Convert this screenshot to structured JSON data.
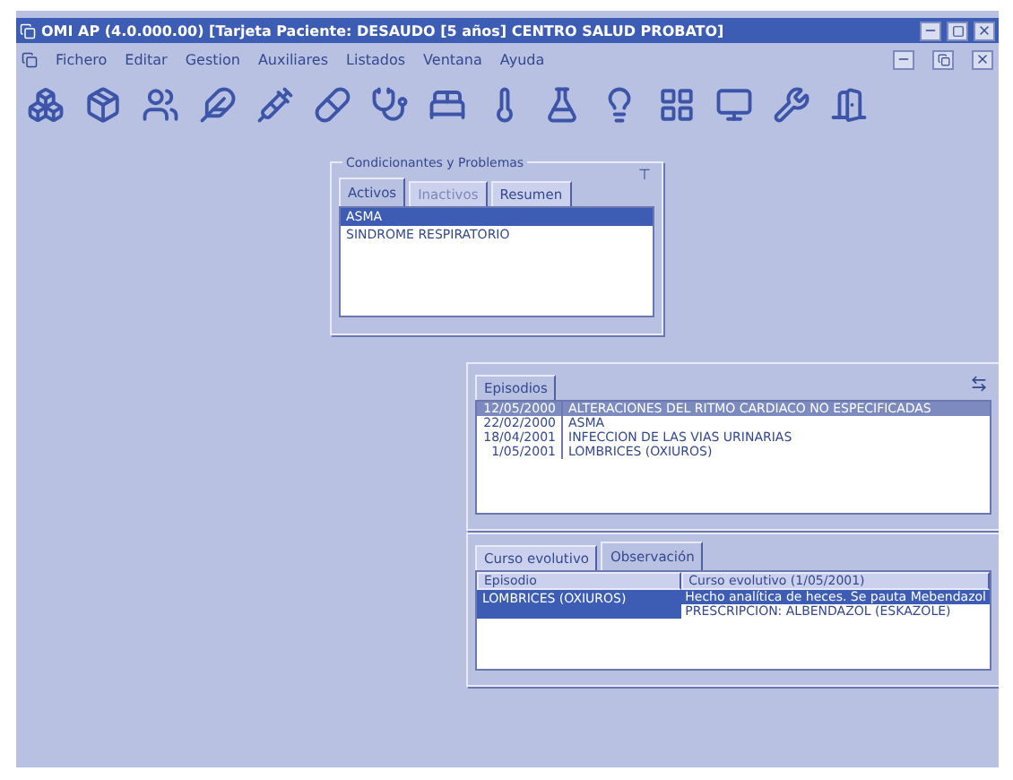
{
  "window": {
    "title": "OMI AP (4.0.000.00)   [Tarjeta Paciente: DESAUDO [5 años] CENTRO SALUD PROBATO]"
  },
  "menu": [
    "Fichero",
    "Editar",
    "Gestion",
    "Auxiliares",
    "Listados",
    "Ventana",
    "Ayuda"
  ],
  "problems_panel": {
    "title": "Condicionantes y Problemas",
    "pin": "⊤",
    "tabs": [
      {
        "label": "Activos",
        "selected": true,
        "disabled": false
      },
      {
        "label": "Inactivos",
        "selected": false,
        "disabled": true
      },
      {
        "label": "Resumen",
        "selected": false,
        "disabled": false
      }
    ],
    "items": [
      {
        "label": "ASMA",
        "selected": true
      },
      {
        "label": "SINDROME RESPIRATORIO",
        "selected": false
      }
    ]
  },
  "episodes_panel": {
    "tabs": [
      {
        "label": "Episodios",
        "selected": true
      }
    ],
    "rows": [
      {
        "date": "12/05/2000",
        "name": "ALTERACIONES DEL RITMO CARDIACO NO ESPECIFICADAS",
        "selected": true
      },
      {
        "date": "22/02/2000",
        "name": "ASMA",
        "selected": false
      },
      {
        "date": "18/04/2001",
        "name": "INFECCION DE LAS VIAS URINARIAS",
        "selected": false
      },
      {
        "date": "1/05/2001",
        "name": "LOMBRICES (OXIUROS)",
        "selected": false
      }
    ]
  },
  "course_panel": {
    "tabs": [
      {
        "label": "Curso evolutivo",
        "selected": false
      },
      {
        "label": "Observación",
        "selected": true
      }
    ],
    "columns": [
      "Episodio",
      "Curso evolutivo (1/05/2001)"
    ],
    "rows": [
      {
        "episode": "LOMBRICES (OXIUROS)",
        "notes": [
          "Hecho analítica de heces. Se pauta Mebendazol",
          "PRESCRIPCION: ALBENDAZOL (ESKAZOLE)"
        ],
        "selected": true
      }
    ]
  }
}
